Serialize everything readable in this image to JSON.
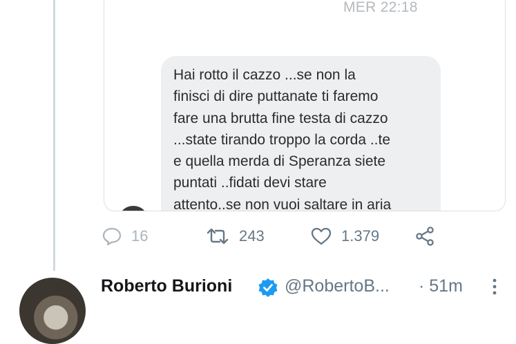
{
  "message": {
    "timestamp": "MER 22:18",
    "lines": [
      "Hai rotto il cazzo ...se non la",
      "finisci di dire puttanate ti faremo",
      "fare una brutta fine testa di cazzo",
      "...state tirando troppo la corda ..te",
      "e quella merda di Speranza siete",
      "puntati ..fidati devi stare",
      "attento..se non vuoi saltare in aria"
    ]
  },
  "actions": {
    "reply_count": "16",
    "retweet_count": "243",
    "like_count": "1.379"
  },
  "next_tweet": {
    "name": "Roberto Burioni",
    "handle": "@RobertoB...",
    "time": "· 51m"
  },
  "colors": {
    "icon_gray": "#657786",
    "verified_blue": "#1d9bf0",
    "bubble_bg": "#eeeff1"
  },
  "icons": [
    "reply-icon",
    "retweet-icon",
    "like-icon",
    "share-icon",
    "verified-icon",
    "more-icon"
  ]
}
